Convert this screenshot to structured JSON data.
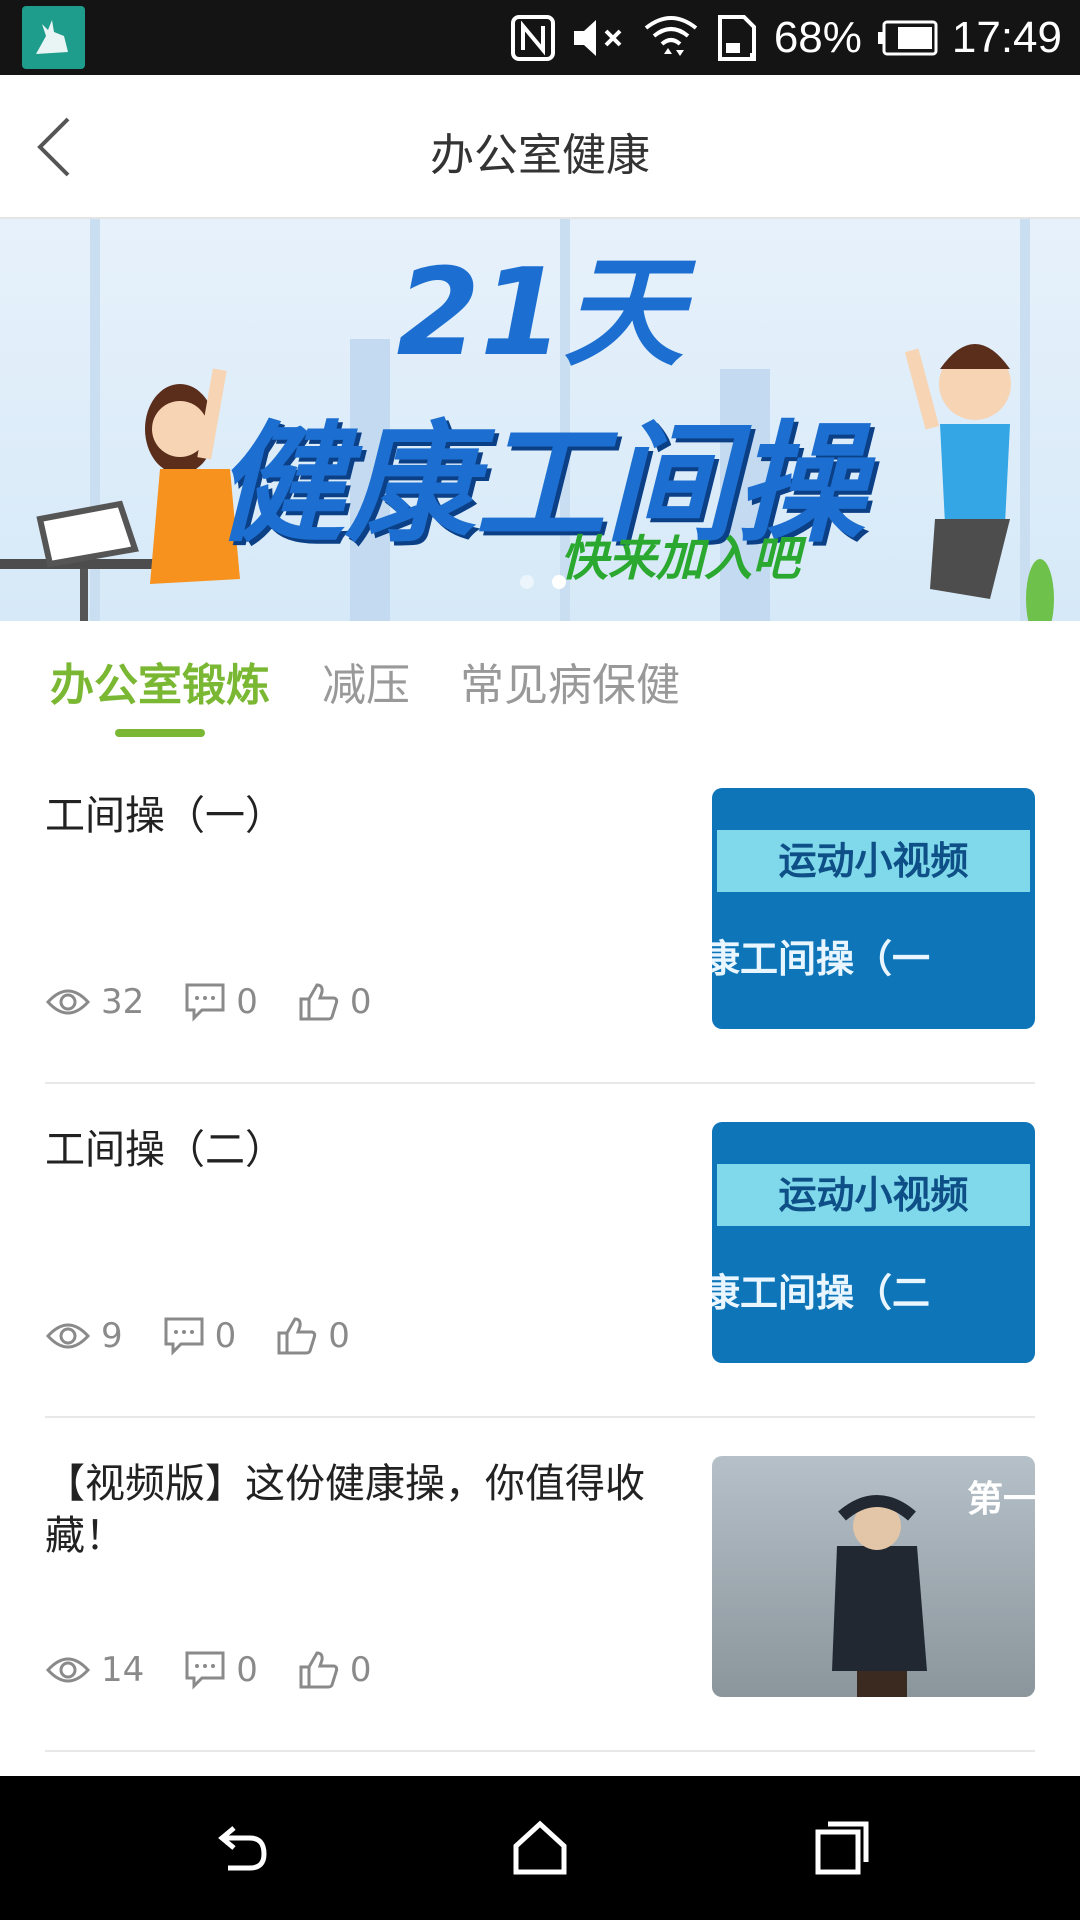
{
  "status_bar": {
    "battery": "68%",
    "time": "17:49"
  },
  "header": {
    "title": "办公室健康"
  },
  "banner": {
    "title": "21天",
    "subtitle": "健康工间操",
    "cta": "快来加入吧",
    "slides_count": 2,
    "active_slide": 2
  },
  "tabs": [
    {
      "label": "办公室锻炼",
      "active": true
    },
    {
      "label": "减压",
      "active": false
    },
    {
      "label": "常见病保健",
      "active": false
    }
  ],
  "articles": [
    {
      "title": "工间操（一）",
      "views": "32",
      "comments": "0",
      "likes": "0",
      "thumb_line1": "运动小视频",
      "thumb_line2": "康工间操（一"
    },
    {
      "title": "工间操（二）",
      "views": "9",
      "comments": "0",
      "likes": "0",
      "thumb_line1": "运动小视频",
      "thumb_line2": "康工间操（二"
    },
    {
      "title": "【视频版】这份健康操，你值得收藏！",
      "views": "14",
      "comments": "0",
      "likes": "0",
      "thumb_text": "第一"
    }
  ],
  "colors": {
    "accent": "#7ab732",
    "thumb_blue": "#0d75b8",
    "status_bar": "#141414"
  }
}
